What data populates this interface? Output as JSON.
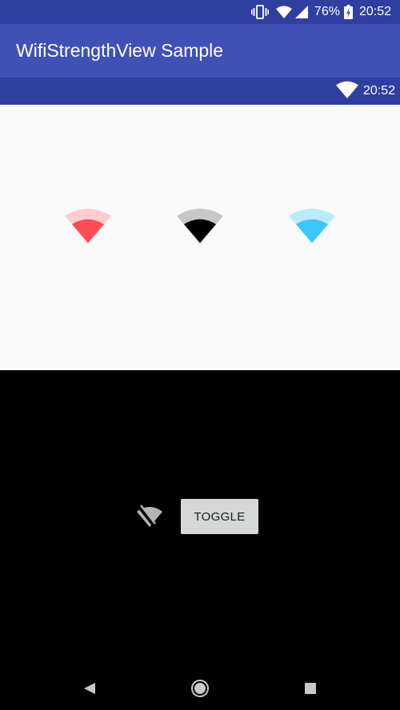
{
  "status_bar": {
    "battery_percent": "76%",
    "time": "20:52",
    "icons": [
      "vibrate-icon",
      "wifi-icon",
      "cell-signal-icon",
      "battery-charging-icon"
    ]
  },
  "app_bar": {
    "title": "WifiStrengthView Sample"
  },
  "sub_bar": {
    "time": "20:52",
    "icon": "wifi-icon"
  },
  "wifi_views": [
    {
      "name": "wifi-strength-red",
      "color": "#ff4d55",
      "track_color": "#ffcdd0"
    },
    {
      "name": "wifi-strength-black",
      "color": "#000000",
      "track_color": "#c7c7c7"
    },
    {
      "name": "wifi-strength-blue",
      "color": "#3cc8f7",
      "track_color": "#b8ecfc"
    }
  ],
  "controls": {
    "wifi_off_icon": "wifi-off-icon",
    "toggle_label": "TOGGLE"
  },
  "nav_bar": {
    "icons": [
      "back-icon",
      "home-icon",
      "recents-icon"
    ]
  },
  "colors": {
    "primary": "#3f51b5",
    "primary_dark": "#303f9f",
    "content_bg": "#fafafa"
  }
}
